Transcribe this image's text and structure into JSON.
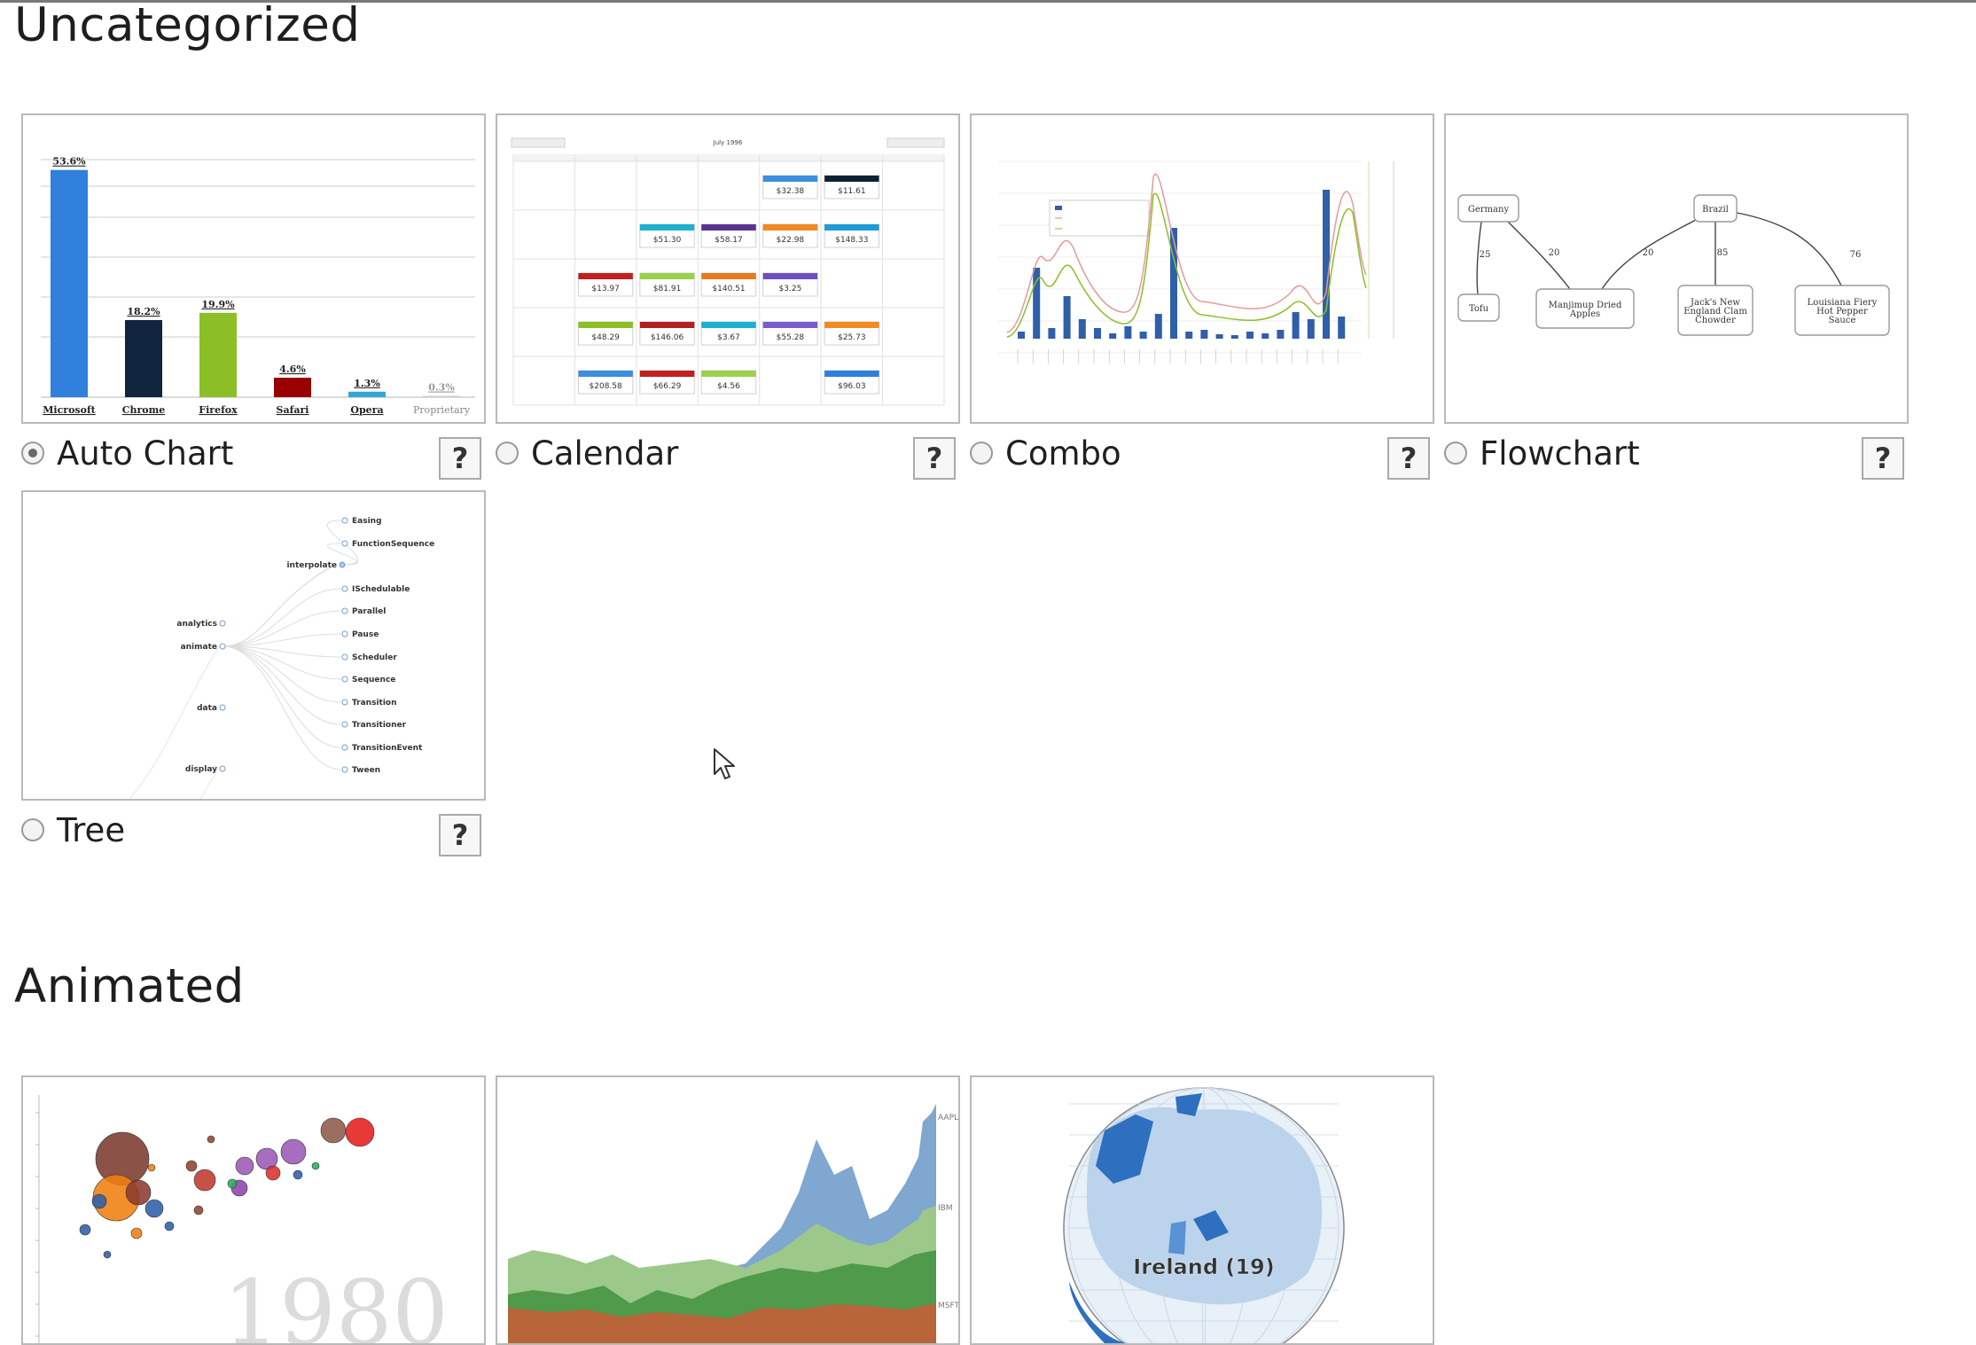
{
  "sections": {
    "uncategorized": {
      "title": "Uncategorized"
    },
    "animated": {
      "title": "Animated"
    }
  },
  "cards": [
    {
      "label": "Auto Chart",
      "selected": true,
      "help": "?"
    },
    {
      "label": "Calendar",
      "selected": false,
      "help": "?"
    },
    {
      "label": "Combo",
      "selected": false,
      "help": "?"
    },
    {
      "label": "Flowchart",
      "selected": false,
      "help": "?"
    },
    {
      "label": "Tree",
      "selected": false,
      "help": "?"
    }
  ],
  "thumbs": {
    "auto_chart": {
      "chart_data": {
        "type": "bar",
        "categories": [
          "Microsoft",
          "Chrome",
          "Firefox",
          "Safari",
          "Opera",
          "Proprietary"
        ],
        "values": [
          53.6,
          18.2,
          19.9,
          4.6,
          1.3,
          0.3
        ],
        "value_labels": [
          "53.6%",
          "18.2%",
          "19.9%",
          "4.6%",
          "1.3%",
          "0.3%"
        ],
        "colors": [
          "#2f7fdc",
          "#10253d",
          "#8cbf26",
          "#990000",
          "#34a5d6",
          "#cccccc"
        ]
      }
    },
    "calendar": {
      "title": "July 1996",
      "amounts": [
        "$32.38",
        "$11.61",
        "$51.30",
        "$58.17",
        "$22.98",
        "$148.33",
        "$13.97",
        "$81.91",
        "$140.51",
        "$3.25",
        "$48.29",
        "$146.06",
        "$3.67",
        "$55.28",
        "$25.73",
        "$208.58",
        "$66.29",
        "$4.56",
        "$96.03"
      ]
    },
    "flowchart": {
      "nodes": [
        "Germany",
        "Brazil",
        "Tofu",
        "Manjimup Dried Apples",
        "Jack's New England Clam Chowder",
        "Louisiana Fiery Hot Pepper Sauce"
      ],
      "edges": [
        "25",
        "20",
        "20",
        "85",
        "76"
      ]
    },
    "tree": {
      "left_nodes": [
        "analytics",
        "animate",
        "data",
        "display"
      ],
      "mid_nodes": [
        "interpolate"
      ],
      "leaves": [
        "Easing",
        "FunctionSequence",
        "ISchedulable",
        "Parallel",
        "Pause",
        "Scheduler",
        "Sequence",
        "Transition",
        "Transitioner",
        "TransitionEvent",
        "Tween"
      ]
    },
    "bubble": {
      "year": "1980"
    },
    "stream": {
      "labels": [
        "AAPL",
        "IBM",
        "MSFT"
      ]
    },
    "globe": {
      "label": "Ireland (19)"
    }
  }
}
